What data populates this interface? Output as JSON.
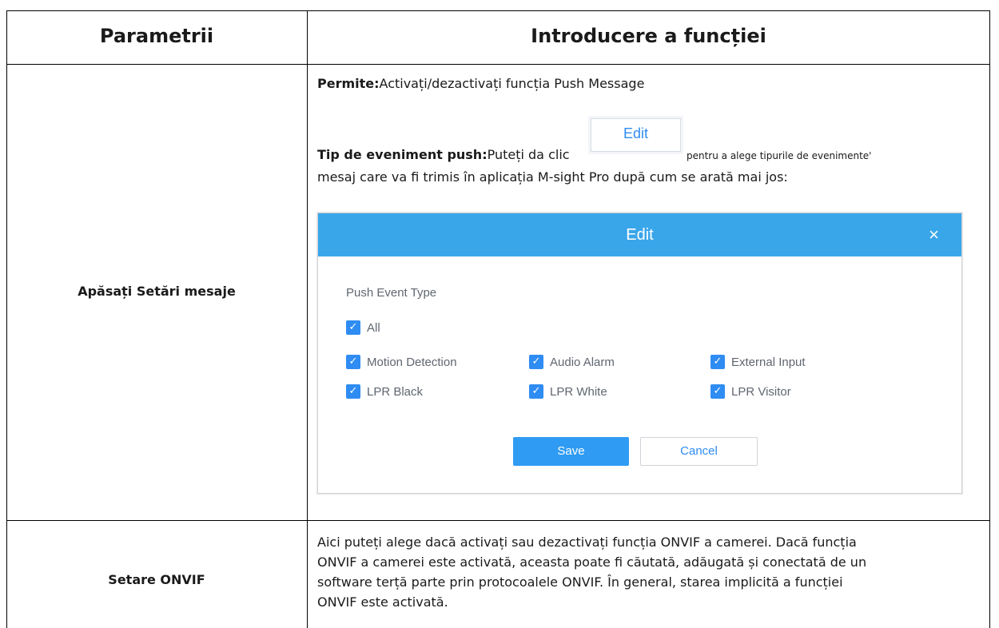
{
  "table": {
    "header": {
      "col1": "Parametrii",
      "col2": "Introducere a funcției"
    },
    "rows": [
      {
        "label": "Apăsați Setări mesaje",
        "enable_title": "Permite:",
        "enable_text": "Activați/dezactivați funcția Push Message",
        "push_title": "Tip de eveniment push:",
        "push_text_before": "Puteți da clic",
        "push_text_after": "pentru a alege tipurile de evenimente'",
        "push_text_line2": "mesaj care va fi trimis în aplicația M-sight Pro după cum se arată mai jos:",
        "edit_button_label": "Edit"
      },
      {
        "label": "Setare ONVIF",
        "text_lines": [
          "Aici puteți alege dacă activați sau dezactivați funcția ONVIF a camerei. Dacă funcția",
          "ONVIF a camerei este activată, aceasta poate fi căutată, adăugată și conectată de un",
          "software terță parte prin protocoalele ONVIF. În general, starea implicită a funcției",
          "ONVIF este activată."
        ]
      }
    ]
  },
  "dialog": {
    "title": "Edit",
    "close_glyph": "×",
    "group_label": "Push Event Type",
    "checkboxes": [
      {
        "label": "All",
        "checked": true
      },
      {
        "label": "Motion Detection",
        "checked": true
      },
      {
        "label": "Audio Alarm",
        "checked": true
      },
      {
        "label": "External Input",
        "checked": true
      },
      {
        "label": "LPR Black",
        "checked": true
      },
      {
        "label": "LPR White",
        "checked": true
      },
      {
        "label": "LPR Visitor",
        "checked": true
      }
    ],
    "save_label": "Save",
    "cancel_label": "Cancel",
    "header_color": "#3aa6ea",
    "accent_color": "#2f8cf2"
  }
}
